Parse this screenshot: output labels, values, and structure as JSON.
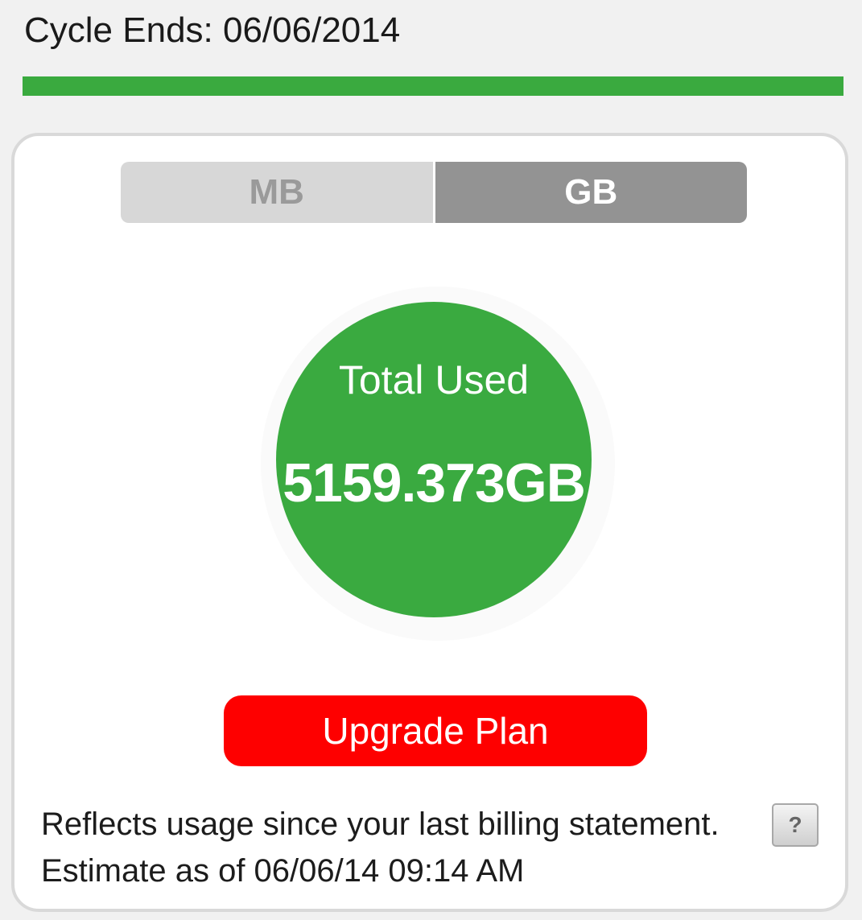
{
  "cycle": {
    "label": "Cycle Ends: 06/06/2014",
    "progress_fraction": 1.0,
    "progress_color": "#3aaa3f"
  },
  "unit_toggle": {
    "options": [
      "MB",
      "GB"
    ],
    "selected": "GB"
  },
  "usage": {
    "label": "Total Used",
    "value": "5159.373GB",
    "circle_color": "#3aaa40"
  },
  "upgrade_button": {
    "label": "Upgrade Plan",
    "color": "#fe0000"
  },
  "footer": {
    "reflects_text": "Reflects usage since your last billing statement.",
    "estimate_text": "Estimate as of 06/06/14 09:14 AM",
    "help_icon": "?"
  }
}
